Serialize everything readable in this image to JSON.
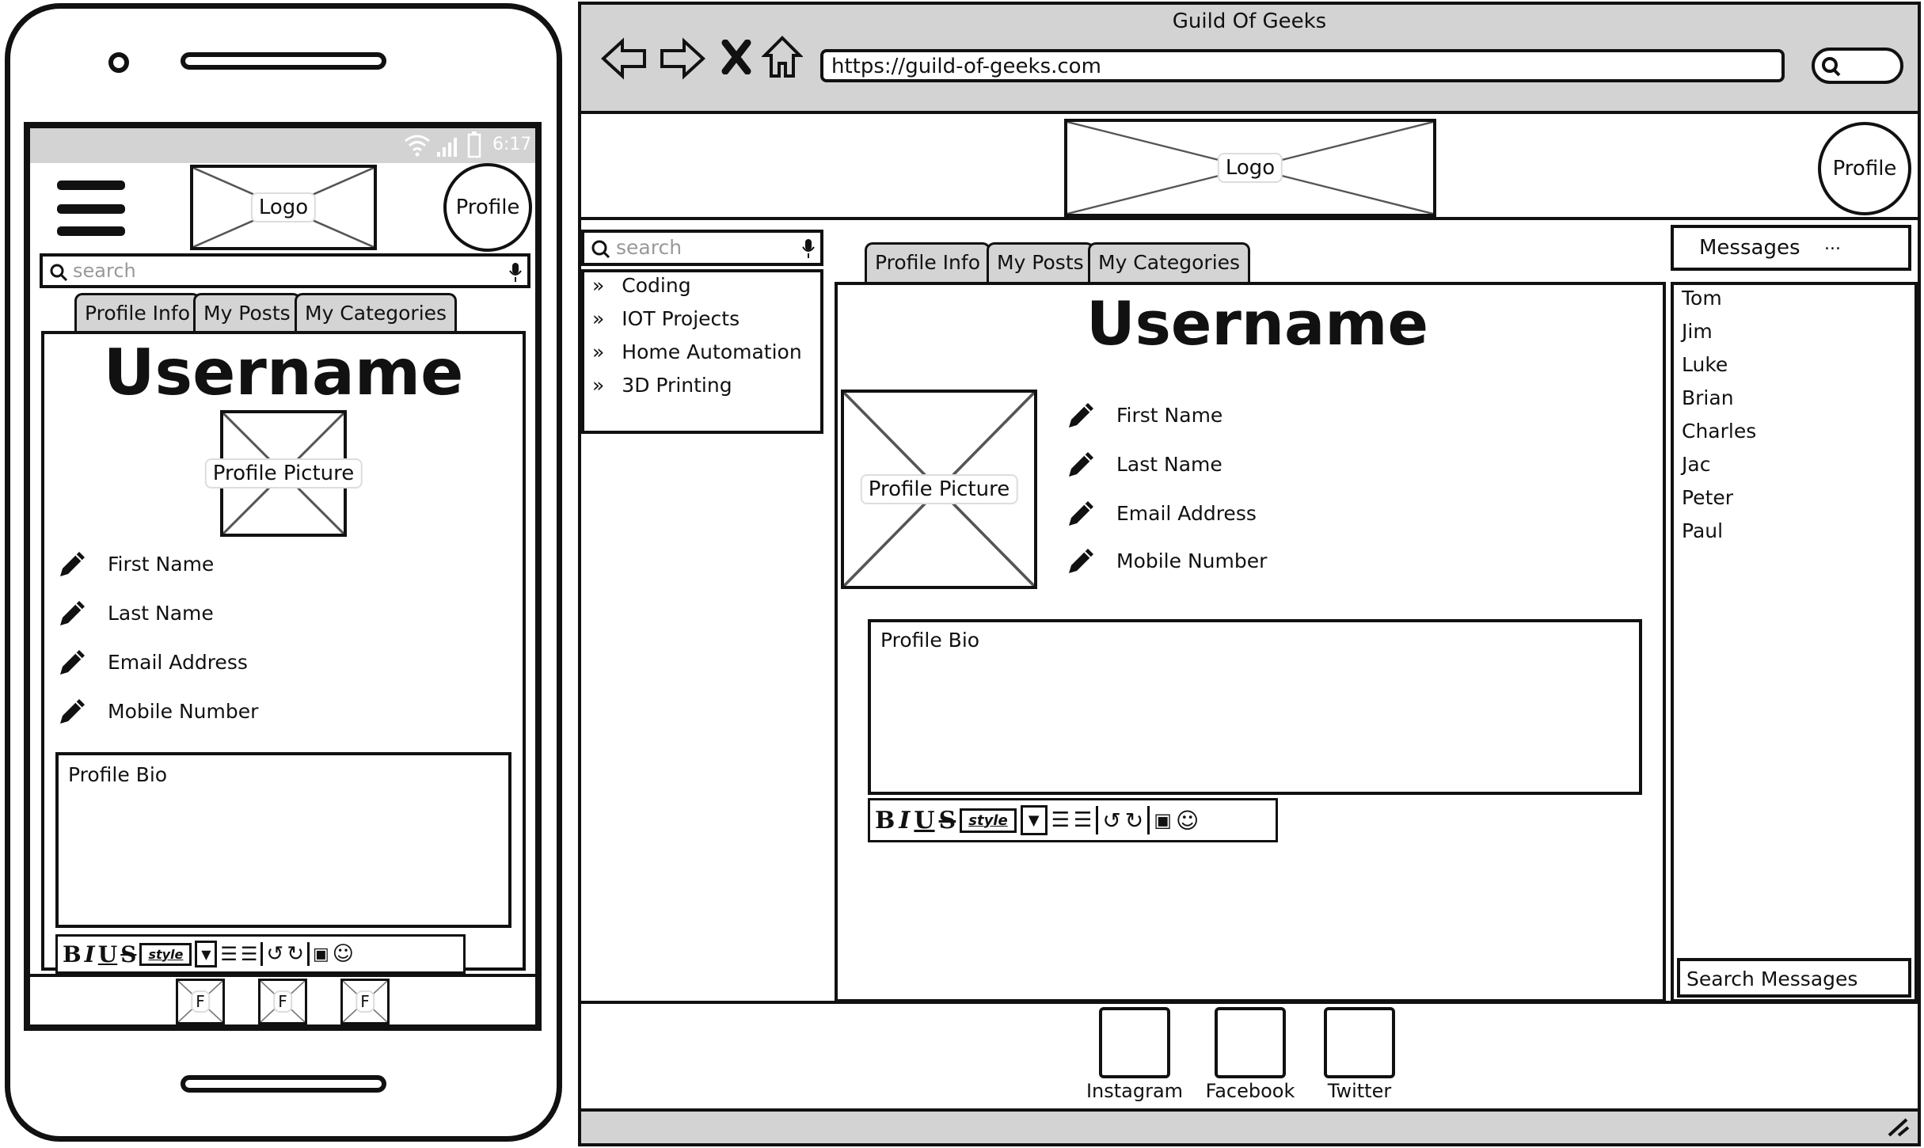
{
  "browser": {
    "title": "Guild Of Geeks",
    "url": "https://guild-of-geeks.com"
  },
  "header": {
    "logo_label": "Logo",
    "profile_label": "Profile"
  },
  "search": {
    "placeholder": "search"
  },
  "categories": [
    "Coding",
    "IOT Projects",
    "Home Automation",
    "3D Printing"
  ],
  "tabs": [
    "Profile Info",
    "My Posts",
    "My Categories"
  ],
  "profile": {
    "username": "Username",
    "picture_label": "Profile Picture",
    "fields": [
      "First Name",
      "Last Name",
      "Email Address",
      "Mobile Number"
    ],
    "bio_label": "Profile Bio"
  },
  "editor": {
    "style_label": "style"
  },
  "messages": {
    "header": "Messages",
    "header_ellipsis": "...",
    "contacts": [
      "Tom",
      "Jim",
      "Luke",
      "Brian",
      "Charles",
      "Jac",
      "Peter",
      "Paul"
    ],
    "search_label": "Search Messages"
  },
  "footer": {
    "social": [
      "Instagram",
      "Facebook",
      "Twitter"
    ]
  },
  "mobile": {
    "status_time": "6:17",
    "social_icon_label": "F"
  }
}
